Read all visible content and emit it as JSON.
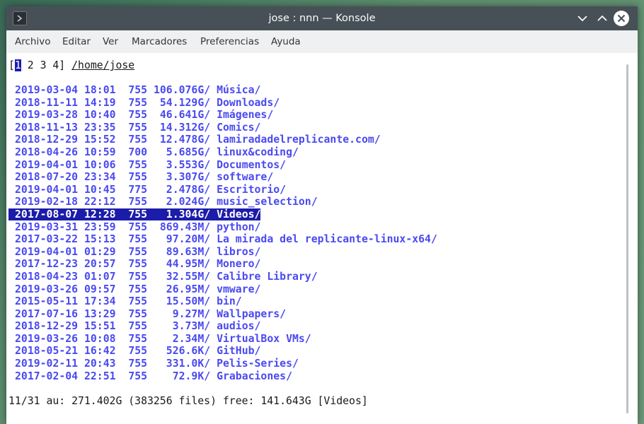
{
  "window": {
    "title": "jose : nnn — Konsole"
  },
  "menubar": {
    "items": [
      "Archivo",
      "Editar",
      "Ver",
      "Marcadores",
      "Preferencias",
      "Ayuda"
    ]
  },
  "terminal": {
    "tabs_prefix": "[",
    "active_tab": "1",
    "other_tabs": " 2 3 4] ",
    "path": "/home/jose",
    "selected_index": 10,
    "entries": [
      {
        "date": "2019-03-04 18:01",
        "perm": "755",
        "size": "106.076G/",
        "name": "Música/"
      },
      {
        "date": "2018-11-11 14:19",
        "perm": "755",
        "size": "54.129G/",
        "name": "Downloads/"
      },
      {
        "date": "2019-03-28 10:40",
        "perm": "755",
        "size": "46.641G/",
        "name": "Imágenes/"
      },
      {
        "date": "2018-11-13 23:35",
        "perm": "755",
        "size": "14.312G/",
        "name": "Comics/"
      },
      {
        "date": "2018-12-29 15:52",
        "perm": "755",
        "size": "12.478G/",
        "name": "lamiradadelreplicante.com/"
      },
      {
        "date": "2018-04-26 10:59",
        "perm": "700",
        "size": "5.685G/",
        "name": "linux&coding/"
      },
      {
        "date": "2019-04-01 10:06",
        "perm": "755",
        "size": "3.553G/",
        "name": "Documentos/"
      },
      {
        "date": "2018-07-20 23:34",
        "perm": "755",
        "size": "3.307G/",
        "name": "software/"
      },
      {
        "date": "2019-04-01 10:45",
        "perm": "775",
        "size": "2.478G/",
        "name": "Escritorio/"
      },
      {
        "date": "2019-02-18 22:12",
        "perm": "755",
        "size": "2.024G/",
        "name": "music_selection/"
      },
      {
        "date": "2017-08-07 12:28",
        "perm": "755",
        "size": "1.304G/",
        "name": "Videos/"
      },
      {
        "date": "2019-03-31 23:59",
        "perm": "755",
        "size": "869.43M/",
        "name": "python/"
      },
      {
        "date": "2017-03-22 15:13",
        "perm": "755",
        "size": "97.20M/",
        "name": "La mirada del replicante-linux-x64/"
      },
      {
        "date": "2019-04-01 01:29",
        "perm": "755",
        "size": "89.63M/",
        "name": "libros/"
      },
      {
        "date": "2017-12-23 20:57",
        "perm": "755",
        "size": "44.95M/",
        "name": "Monero/"
      },
      {
        "date": "2018-04-23 01:07",
        "perm": "755",
        "size": "32.55M/",
        "name": "Calibre Library/"
      },
      {
        "date": "2019-03-26 09:57",
        "perm": "755",
        "size": "26.95M/",
        "name": "vmware/"
      },
      {
        "date": "2015-05-11 17:34",
        "perm": "755",
        "size": "15.50M/",
        "name": "bin/"
      },
      {
        "date": "2017-07-16 13:29",
        "perm": "755",
        "size": "9.27M/",
        "name": "Wallpapers/"
      },
      {
        "date": "2018-12-29 15:51",
        "perm": "755",
        "size": "3.73M/",
        "name": "audios/"
      },
      {
        "date": "2019-03-26 10:08",
        "perm": "755",
        "size": "2.34M/",
        "name": "VirtualBox VMs/"
      },
      {
        "date": "2018-05-21 16:42",
        "perm": "755",
        "size": "526.6K/",
        "name": "GitHub/"
      },
      {
        "date": "2019-02-11 20:43",
        "perm": "755",
        "size": "331.0K/",
        "name": "Pelis-Series/"
      },
      {
        "date": "2017-02-04 22:51",
        "perm": "755",
        "size": "72.9K/",
        "name": "Grabaciones/"
      }
    ],
    "status_line": "11/31 au: 271.402G (383256 files) free: 141.643G [Videos]"
  },
  "colors": {
    "titlebar": "#475057",
    "dir_text": "#4a4af0",
    "selection": "#1c1caa",
    "menubar": "#eff0f1"
  },
  "icons": {
    "app": "konsole-terminal-icon",
    "minimize": "chevron-down-icon",
    "maximize": "chevron-up-icon",
    "close": "close-icon"
  }
}
